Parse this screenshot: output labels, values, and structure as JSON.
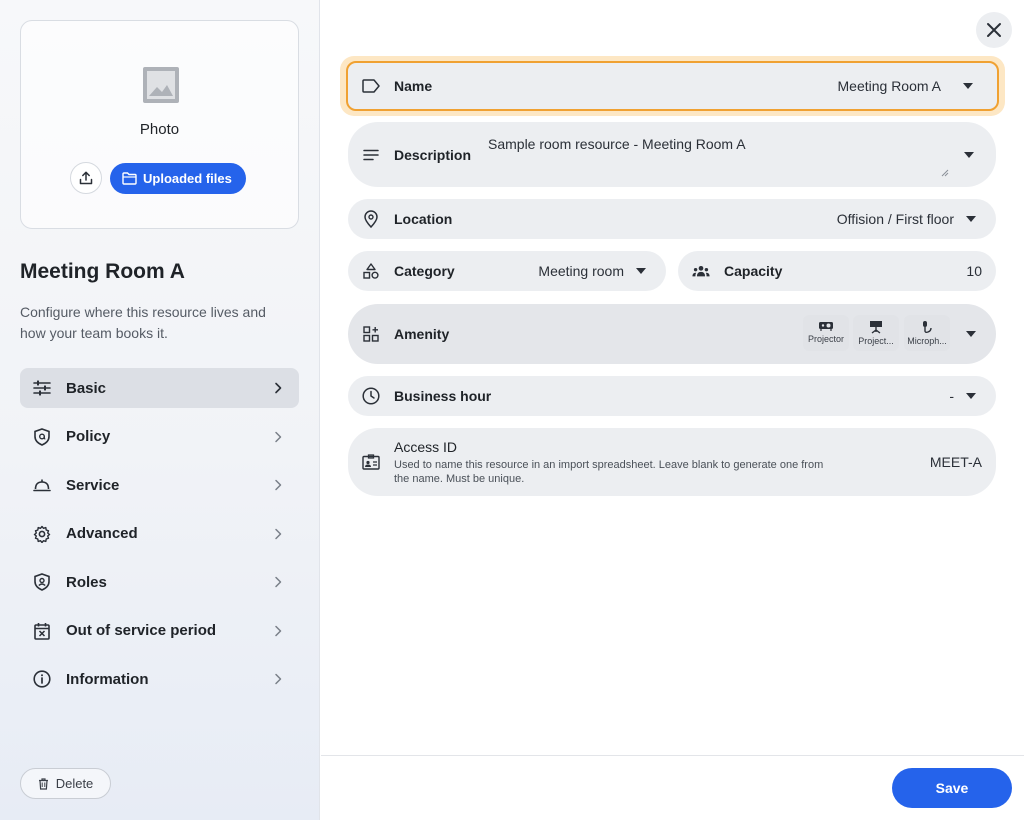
{
  "sidebar": {
    "photo_label": "Photo",
    "uploaded_files_label": "Uploaded files",
    "resource_title": "Meeting Room A",
    "resource_description": "Configure where this resource lives and how your team books it.",
    "nav_items": [
      {
        "label": "Basic",
        "icon": "sliders-icon",
        "active": true
      },
      {
        "label": "Policy",
        "icon": "shield-at-icon"
      },
      {
        "label": "Service",
        "icon": "bell-service-icon"
      },
      {
        "label": "Advanced",
        "icon": "gear-icon"
      },
      {
        "label": "Roles",
        "icon": "shield-user-icon"
      },
      {
        "label": "Out of service period",
        "icon": "calendar-x-icon"
      },
      {
        "label": "Information",
        "icon": "info-icon"
      }
    ],
    "delete_label": "Delete"
  },
  "form": {
    "name": {
      "label": "Name",
      "value": "Meeting Room A"
    },
    "description": {
      "label": "Description",
      "value": "Sample room resource - Meeting Room A"
    },
    "location": {
      "label": "Location",
      "value": "Offision / First floor"
    },
    "category": {
      "label": "Category",
      "value": "Meeting room"
    },
    "capacity": {
      "label": "Capacity",
      "value": "10"
    },
    "amenity": {
      "label": "Amenity",
      "items": [
        "Projector",
        "Project...",
        "Microph..."
      ]
    },
    "business_hour": {
      "label": "Business hour",
      "value": "-"
    },
    "access_id": {
      "label": "Access ID",
      "help": "Used to name this resource in an import spreadsheet. Leave blank to generate one from the name. Must be unique.",
      "value": "MEET-A"
    }
  },
  "footer": {
    "save_label": "Save"
  },
  "colors": {
    "accent": "#2563eb",
    "focus": "#f0a132",
    "field_bg": "#eceef1"
  }
}
